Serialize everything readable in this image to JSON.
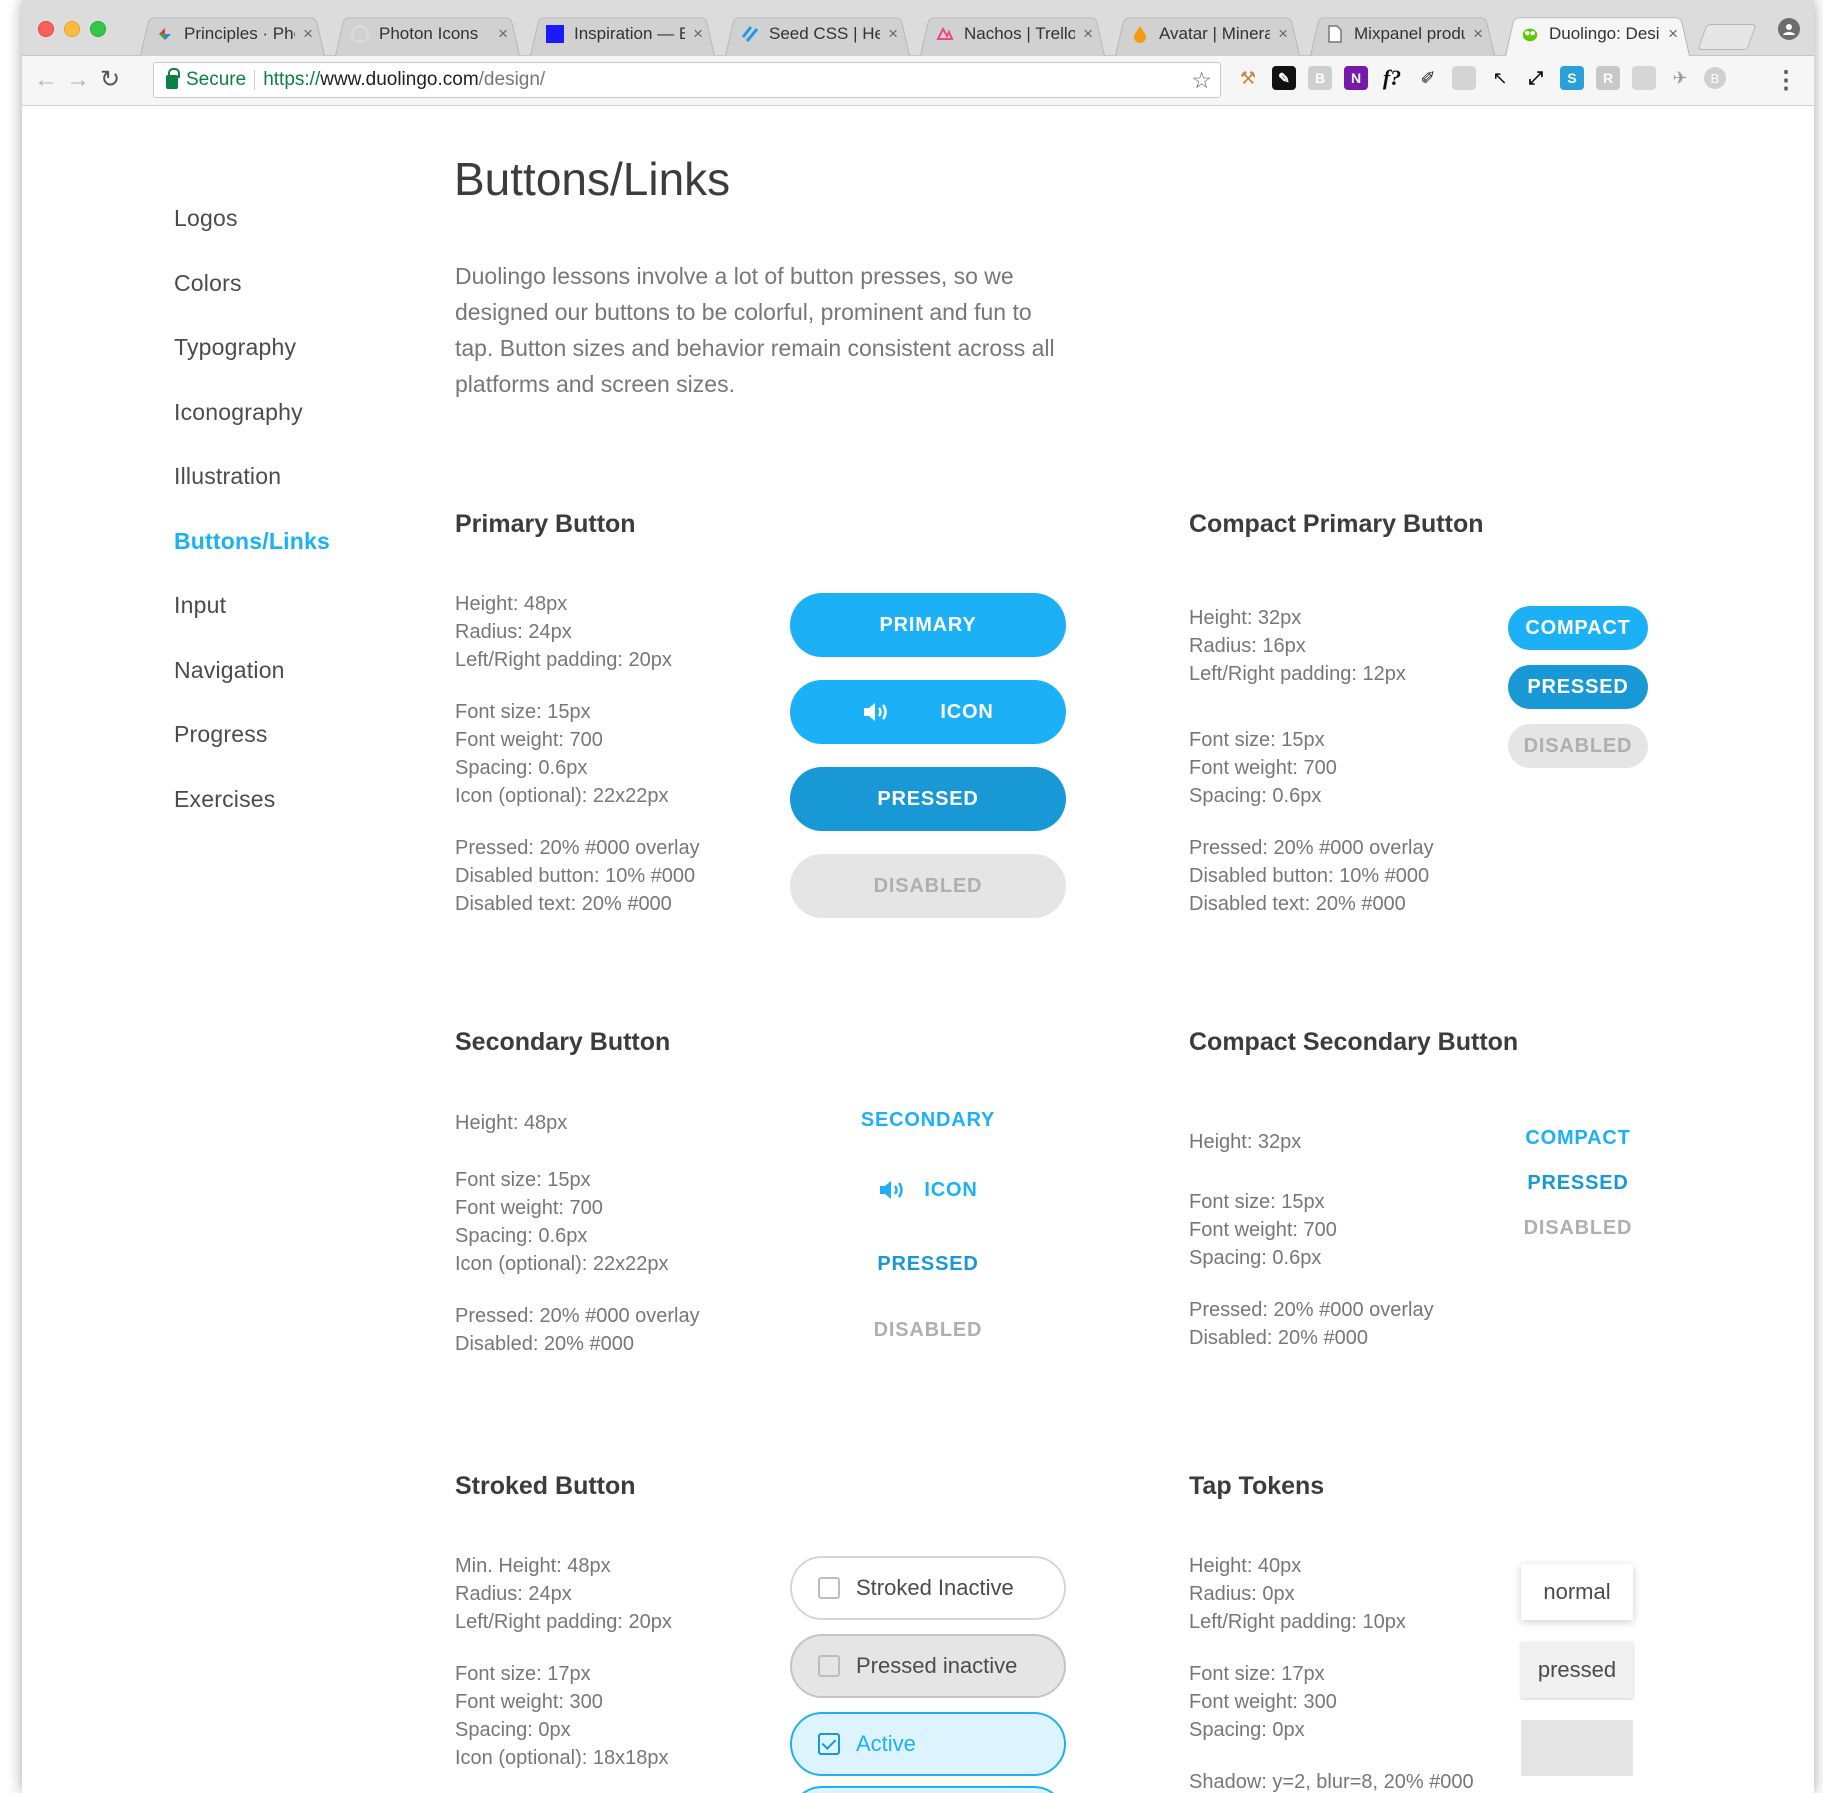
{
  "browser": {
    "tabs": [
      {
        "label": "Principles · Pho",
        "icon": "principles-favicon"
      },
      {
        "label": "Photon Icons",
        "icon": "photon-favicon"
      },
      {
        "label": "Inspiration — B",
        "icon": "inspiration-favicon"
      },
      {
        "label": "Seed CSS | Hel",
        "icon": "seed-favicon"
      },
      {
        "label": "Nachos | Trello",
        "icon": "nachos-favicon"
      },
      {
        "label": "Avatar | Minera",
        "icon": "avatar-favicon"
      },
      {
        "label": "Mixpanel produ",
        "icon": "document-favicon"
      },
      {
        "label": "Duolingo: Desig",
        "icon": "duolingo-favicon",
        "active": true
      }
    ],
    "secure_label": "Secure",
    "url_scheme": "https://",
    "url_host": "www.duolingo.com",
    "url_path": "/design/",
    "extensions": [
      "f?"
    ]
  },
  "sidebar": {
    "items": [
      {
        "label": "Logos"
      },
      {
        "label": "Colors"
      },
      {
        "label": "Typography"
      },
      {
        "label": "Iconography"
      },
      {
        "label": "Illustration"
      },
      {
        "label": "Buttons/Links",
        "active": true
      },
      {
        "label": "Input"
      },
      {
        "label": "Navigation"
      },
      {
        "label": "Progress"
      },
      {
        "label": "Exercises"
      }
    ]
  },
  "main": {
    "title": "Buttons/Links",
    "intro": "Duolingo lessons involve a lot of button presses, so we designed our buttons to be colorful, prominent and fun to tap. Button sizes and behavior remain consistent across all platforms and screen sizes.",
    "primary": {
      "title": "Primary Button",
      "spec1": [
        "Height: 48px",
        "Radius: 24px",
        "Left/Right padding: 20px"
      ],
      "spec2": [
        "Font size: 15px",
        "Font weight: 700",
        "Spacing: 0.6px",
        "Icon (optional): 22x22px"
      ],
      "spec3": [
        "Pressed: 20% #000 overlay",
        "Disabled button: 10% #000",
        "Disabled text: 20% #000"
      ],
      "buttons": {
        "primary": "PRIMARY",
        "icon": "ICON",
        "pressed": "PRESSED",
        "disabled": "DISABLED"
      }
    },
    "compact_primary": {
      "title": "Compact Primary Button",
      "spec1": [
        "Height: 32px",
        "Radius: 16px",
        "Left/Right padding: 12px"
      ],
      "spec2": [
        "Font size: 15px",
        "Font weight: 700",
        "Spacing: 0.6px"
      ],
      "spec3": [
        "Pressed: 20% #000 overlay",
        "Disabled button: 10% #000",
        "Disabled text: 20% #000"
      ],
      "buttons": {
        "compact": "COMPACT",
        "pressed": "PRESSED",
        "disabled": "DISABLED"
      }
    },
    "secondary": {
      "title": "Secondary Button",
      "spec1": [
        "Height: 48px"
      ],
      "spec2": [
        "Font size: 15px",
        "Font weight: 700",
        "Spacing: 0.6px",
        "Icon (optional): 22x22px"
      ],
      "spec3": [
        "Pressed: 20% #000 overlay",
        "Disabled: 20% #000"
      ],
      "buttons": {
        "secondary": "SECONDARY",
        "icon": "ICON",
        "pressed": "PRESSED",
        "disabled": "DISABLED"
      }
    },
    "compact_secondary": {
      "title": "Compact Secondary Button",
      "spec1": [
        "Height: 32px"
      ],
      "spec2": [
        "Font size: 15px",
        "Font weight: 700",
        "Spacing: 0.6px"
      ],
      "spec3": [
        "Pressed: 20% #000 overlay",
        "Disabled: 20% #000"
      ],
      "buttons": {
        "compact": "COMPACT",
        "pressed": "PRESSED",
        "disabled": "DISABLED"
      }
    },
    "stroked": {
      "title": "Stroked Button",
      "spec1": [
        "Min. Height: 48px",
        "Radius: 24px",
        "Left/Right padding: 20px"
      ],
      "spec2": [
        "Font size: 17px",
        "Font weight: 300",
        "Spacing: 0px",
        "Icon (optional): 18x18px"
      ],
      "buttons": {
        "inactive": "Stroked Inactive",
        "pressed_inactive": "Pressed inactive",
        "active": "Active"
      }
    },
    "tap_tokens": {
      "title": "Tap Tokens",
      "spec1": [
        "Height: 40px",
        "Radius: 0px",
        "Left/Right padding: 10px"
      ],
      "spec2": [
        "Font size: 17px",
        "Font weight: 300",
        "Spacing: 0px"
      ],
      "spec3": [
        "Shadow: y=2, blur=8, 20% #000"
      ],
      "tokens": {
        "normal": "normal",
        "pressed": "pressed"
      }
    }
  },
  "colors": {
    "accent": "#1cb0f6",
    "accent_pressed": "#1899d6",
    "disabled_bg": "#e5e5e5",
    "disabled_text": "#afafaf"
  }
}
